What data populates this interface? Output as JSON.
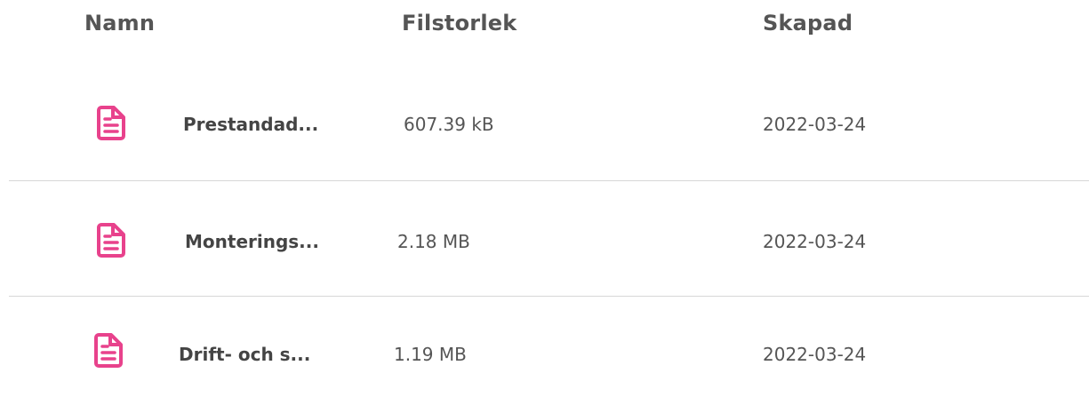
{
  "table": {
    "headers": {
      "name": "Namn",
      "size": "Filstorlek",
      "created": "Skapad"
    },
    "rows": [
      {
        "icon": "document-icon",
        "name": "Prestandad...",
        "size": "607.39 kB",
        "created": "2022-03-24"
      },
      {
        "icon": "document-icon",
        "name": "Monterings...",
        "size": "2.18 MB",
        "created": "2022-03-24"
      },
      {
        "icon": "document-icon",
        "name": "Drift- och s...",
        "size": "1.19 MB",
        "created": "2022-03-24"
      }
    ]
  },
  "colors": {
    "icon": "#e8428c",
    "text": "#555555",
    "divider": "#d7d7d7"
  }
}
